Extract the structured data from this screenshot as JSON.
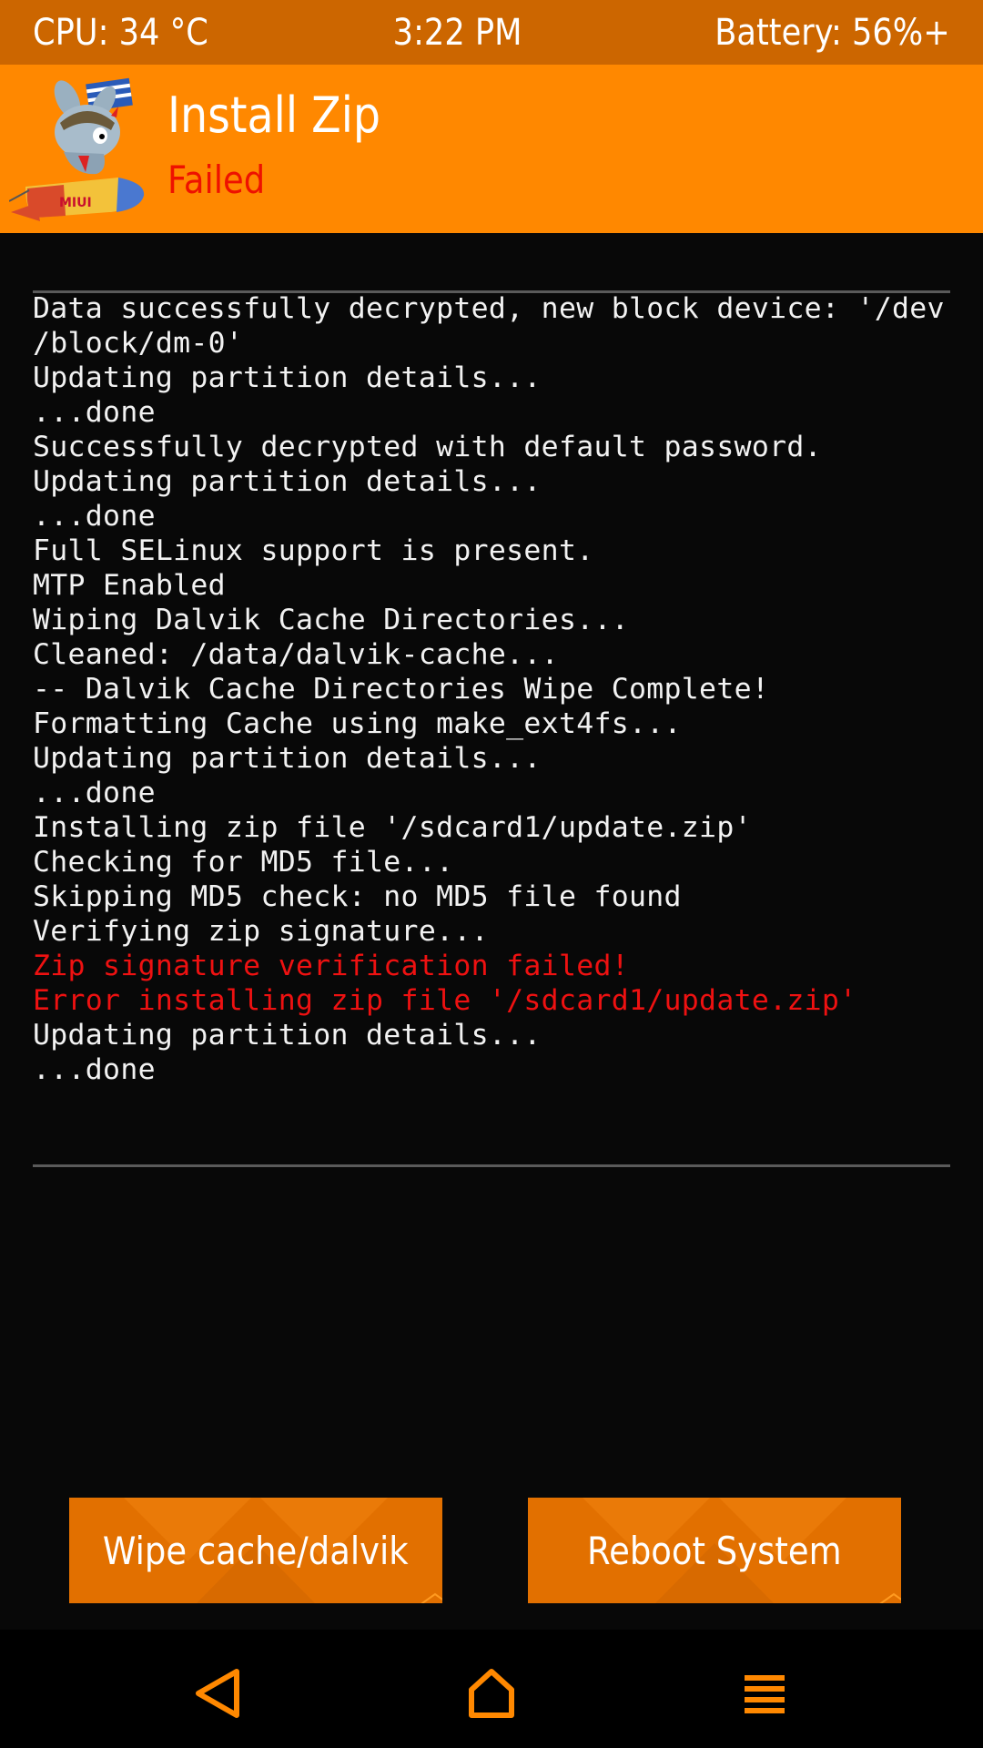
{
  "status_bar": {
    "cpu": "CPU: 34 °C",
    "time": "3:22 PM",
    "battery": "Battery: 56%+"
  },
  "header": {
    "title": "Install Zip",
    "status": "Failed",
    "logo_text": "MIUI"
  },
  "console": {
    "lines": [
      {
        "text": "Data successfully decrypted, new block device: '/dev",
        "error": false
      },
      {
        "text": "/block/dm-0'",
        "error": false
      },
      {
        "text": "Updating partition details...",
        "error": false
      },
      {
        "text": "...done",
        "error": false
      },
      {
        "text": "Successfully decrypted with default password.",
        "error": false
      },
      {
        "text": "Updating partition details...",
        "error": false
      },
      {
        "text": "...done",
        "error": false
      },
      {
        "text": "Full SELinux support is present.",
        "error": false
      },
      {
        "text": "MTP Enabled",
        "error": false
      },
      {
        "text": "Wiping Dalvik Cache Directories...",
        "error": false
      },
      {
        "text": "Cleaned: /data/dalvik-cache...",
        "error": false
      },
      {
        "text": "-- Dalvik Cache Directories Wipe Complete!",
        "error": false
      },
      {
        "text": "Formatting Cache using make_ext4fs...",
        "error": false
      },
      {
        "text": "Updating partition details...",
        "error": false
      },
      {
        "text": "...done",
        "error": false
      },
      {
        "text": "Installing zip file '/sdcard1/update.zip'",
        "error": false
      },
      {
        "text": "Checking for MD5 file...",
        "error": false
      },
      {
        "text": "Skipping MD5 check: no MD5 file found",
        "error": false
      },
      {
        "text": "Verifying zip signature...",
        "error": false
      },
      {
        "text": "Zip signature verification failed!",
        "error": true
      },
      {
        "text": "Error installing zip file '/sdcard1/update.zip'",
        "error": true
      },
      {
        "text": "Updating partition details...",
        "error": false
      },
      {
        "text": "...done",
        "error": false
      }
    ]
  },
  "buttons": {
    "wipe_label": "Wipe cache/dalvik",
    "reboot_label": "Reboot System"
  },
  "nav_bar": {
    "icons": [
      "back-icon",
      "home-icon",
      "menu-icon"
    ]
  },
  "colors": {
    "status_bar": "#cc6600",
    "header": "#ff8800",
    "button": "#e06f00",
    "error_text": "#ee1111",
    "nav_icon": "#ff8800",
    "background": "#080808"
  }
}
